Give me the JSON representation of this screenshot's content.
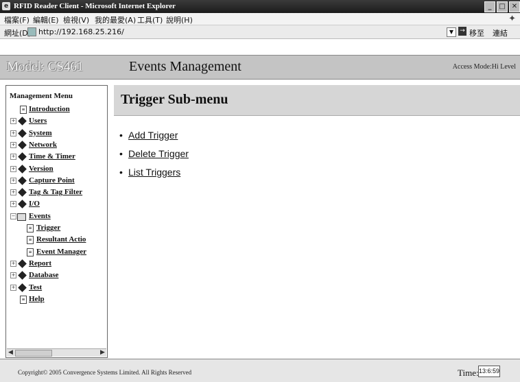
{
  "window": {
    "title": "RFID Reader Client - Microsoft Internet Explorer",
    "controls": [
      "_",
      "□",
      "✕"
    ]
  },
  "menubar": {
    "items": [
      "檔案(F)",
      "編輯(E)",
      "檢視(V)",
      "我的最愛(A)",
      "工具(T)",
      "說明(H)"
    ]
  },
  "addressbar": {
    "label": "網址(D)",
    "url": "http://192.168.25.216/",
    "go_label": "移至",
    "links_label": "連結"
  },
  "header": {
    "model": "Model: CS461",
    "title": "Events Management",
    "access": "Access Mode:Hi Level"
  },
  "sidebar": {
    "title": "Management Menu",
    "items": [
      {
        "label": "Introduction",
        "type": "doc"
      },
      {
        "label": "Users",
        "type": "node"
      },
      {
        "label": "System",
        "type": "node"
      },
      {
        "label": "Network",
        "type": "node"
      },
      {
        "label": "Time & Timer",
        "type": "node"
      },
      {
        "label": "Version",
        "type": "node"
      },
      {
        "label": "Capture Point",
        "type": "node"
      },
      {
        "label": "Tag & Tag Filter",
        "type": "node"
      },
      {
        "label": "I/O",
        "type": "node"
      },
      {
        "label": "Events",
        "type": "open"
      },
      {
        "label": "Trigger",
        "type": "child"
      },
      {
        "label": "Resultant Actio",
        "type": "child"
      },
      {
        "label": "Event Manager",
        "type": "child"
      },
      {
        "label": "Report",
        "type": "node"
      },
      {
        "label": "Database",
        "type": "node"
      },
      {
        "label": "Test",
        "type": "node"
      },
      {
        "label": "Help",
        "type": "doc"
      }
    ]
  },
  "main": {
    "heading": "Trigger Sub-menu",
    "actions": [
      "Add Trigger",
      "Delete Trigger",
      "List Triggers"
    ]
  },
  "footer": {
    "copyright": "Copyright© 2005 Convergence Systems Limited. All Rights Reserved",
    "time_label": "Time:",
    "time_value": "13:6:59"
  }
}
